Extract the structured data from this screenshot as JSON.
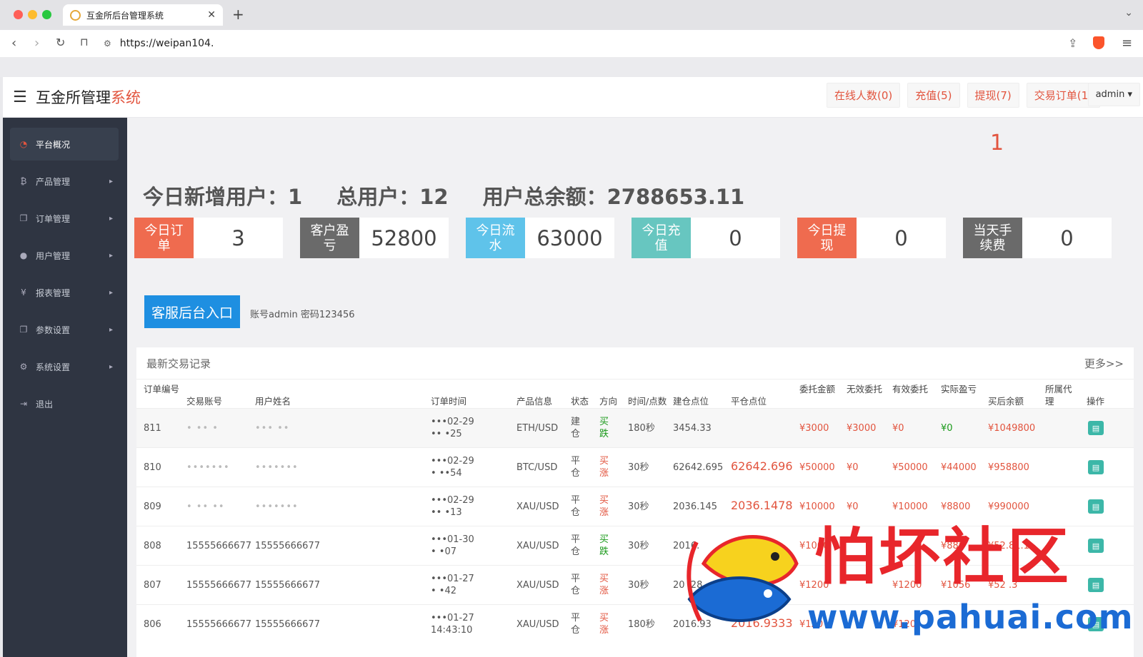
{
  "browser": {
    "tab_title": "互金所后台管理系统",
    "url": "https://weipan104."
  },
  "header": {
    "title_main": "互金所管理",
    "title_accent": "系统",
    "links": [
      "在线人数(0)",
      "充值(5)",
      "提现(7)",
      "交易订单(1)"
    ],
    "admin": "admin"
  },
  "sidebar": {
    "items": [
      {
        "label": "平台概况",
        "icon": "dashboard-icon",
        "active": true
      },
      {
        "label": "产品管理",
        "icon": "bitcoin-icon"
      },
      {
        "label": "订单管理",
        "icon": "copy-icon"
      },
      {
        "label": "用户管理",
        "icon": "user-icon"
      },
      {
        "label": "报表管理",
        "icon": "yen-icon"
      },
      {
        "label": "参数设置",
        "icon": "copy-icon"
      },
      {
        "label": "系统设置",
        "icon": "gears-icon"
      },
      {
        "label": "退出",
        "icon": "signout-icon"
      }
    ]
  },
  "main": {
    "badge_number": "1",
    "summary": {
      "new_users_label": "今日新增用户：",
      "new_users": "1",
      "total_users_label": "总用户：",
      "total_users": "12",
      "balance_label": "用户总余额：",
      "balance": "2788653.11"
    },
    "stats": [
      {
        "label": "今日订单",
        "value": "3",
        "color": "#ef6b4f"
      },
      {
        "label": "客户盈亏",
        "value": "52800",
        "color": "#6a6a6a"
      },
      {
        "label": "今日流水",
        "value": "63000",
        "color": "#5fc3ea"
      },
      {
        "label": "今日充值",
        "value": "0",
        "color": "#67c6c0"
      },
      {
        "label": "今日提现",
        "value": "0",
        "color": "#ef6b4f"
      },
      {
        "label": "当天手续费",
        "value": "0",
        "color": "#6a6a6a"
      }
    ],
    "kf_button": "客服后台入口",
    "kf_note": "账号admin 密码123456"
  },
  "trades": {
    "title": "最新交易记录",
    "more": "更多>>",
    "columns": [
      "订单编号",
      "交易账号",
      "用户姓名",
      "订单时间",
      "产品信息",
      "状态",
      "方向",
      "时间/点数",
      "建仓点位",
      "平仓点位",
      "委托金额",
      "无效委托",
      "有效委托",
      "实际盈亏",
      "买后余额",
      "所属代理",
      "操作"
    ],
    "rows": [
      {
        "id": "811",
        "account": "• •• •",
        "name": "••• ••",
        "time1": "•••02-29",
        "time2": "•• •25",
        "product": "ETH/USD",
        "status": "建仓",
        "dir": "买跌",
        "dur": "180秒",
        "open": "3454.33",
        "close": "",
        "amount": "¥3000",
        "invalid": "¥3000",
        "valid": "¥0",
        "pl": "¥0",
        "balance": "¥1049800"
      },
      {
        "id": "810",
        "account": "•••••••",
        "name": "•••••••",
        "time1": "•••02-29",
        "time2": "• ••54",
        "product": "BTC/USD",
        "status": "平仓",
        "dir": "买涨",
        "dur": "30秒",
        "open": "62642.695",
        "close": "62642.696",
        "amount": "¥50000",
        "invalid": "¥0",
        "valid": "¥50000",
        "pl": "¥44000",
        "balance": "¥958800"
      },
      {
        "id": "809",
        "account": "• •• ••",
        "name": "•••••••",
        "time1": "•••02-29",
        "time2": "•• •13",
        "product": "XAU/USD",
        "status": "平仓",
        "dir": "买涨",
        "dur": "30秒",
        "open": "2036.145",
        "close": "2036.1478",
        "amount": "¥10000",
        "invalid": "¥0",
        "valid": "¥10000",
        "pl": "¥8800",
        "balance": "¥990000"
      },
      {
        "id": "808",
        "account": "15555666677",
        "name": "15555666677",
        "time1": "•••01-30",
        "time2": "• •07",
        "product": "XAU/USD",
        "status": "平仓",
        "dir": "买跌",
        "dur": "30秒",
        "open": "2016.",
        "close": "",
        "amount": "¥1000",
        "invalid": "",
        "valid": "",
        "pl": "¥880",
        "balance": "¥52.81.1"
      },
      {
        "id": "807",
        "account": "15555666677",
        "name": "15555666677",
        "time1": "•••01-27",
        "time2": "• •42",
        "product": "XAU/USD",
        "status": "平仓",
        "dir": "买涨",
        "dur": "30秒",
        "open": "20 .28",
        "close": "",
        "amount": "¥1200",
        "invalid": "",
        "valid": "¥1200",
        "pl": "¥1056",
        "balance": "¥52 .3"
      },
      {
        "id": "806",
        "account": "15555666677",
        "name": "15555666677",
        "time1": "•••01-27",
        "time2": "14:43:10",
        "product": "XAU/USD",
        "status": "平仓",
        "dir": "买涨",
        "dur": "180秒",
        "open": "2016.93",
        "close": "2016.9333",
        "amount": "¥120",
        "invalid": "",
        "valid": "¥120",
        "pl": "",
        "balance": ""
      }
    ]
  },
  "watermark": {
    "text": "怕坏社区",
    "url": "www.pahuai.com"
  },
  "colors": {
    "accent": "#e2543e",
    "sidebar_bg": "#2f3542",
    "buy_down": "#1a9a1a",
    "buy_up": "#e2543e",
    "kf_blue": "#1e8fe1"
  }
}
